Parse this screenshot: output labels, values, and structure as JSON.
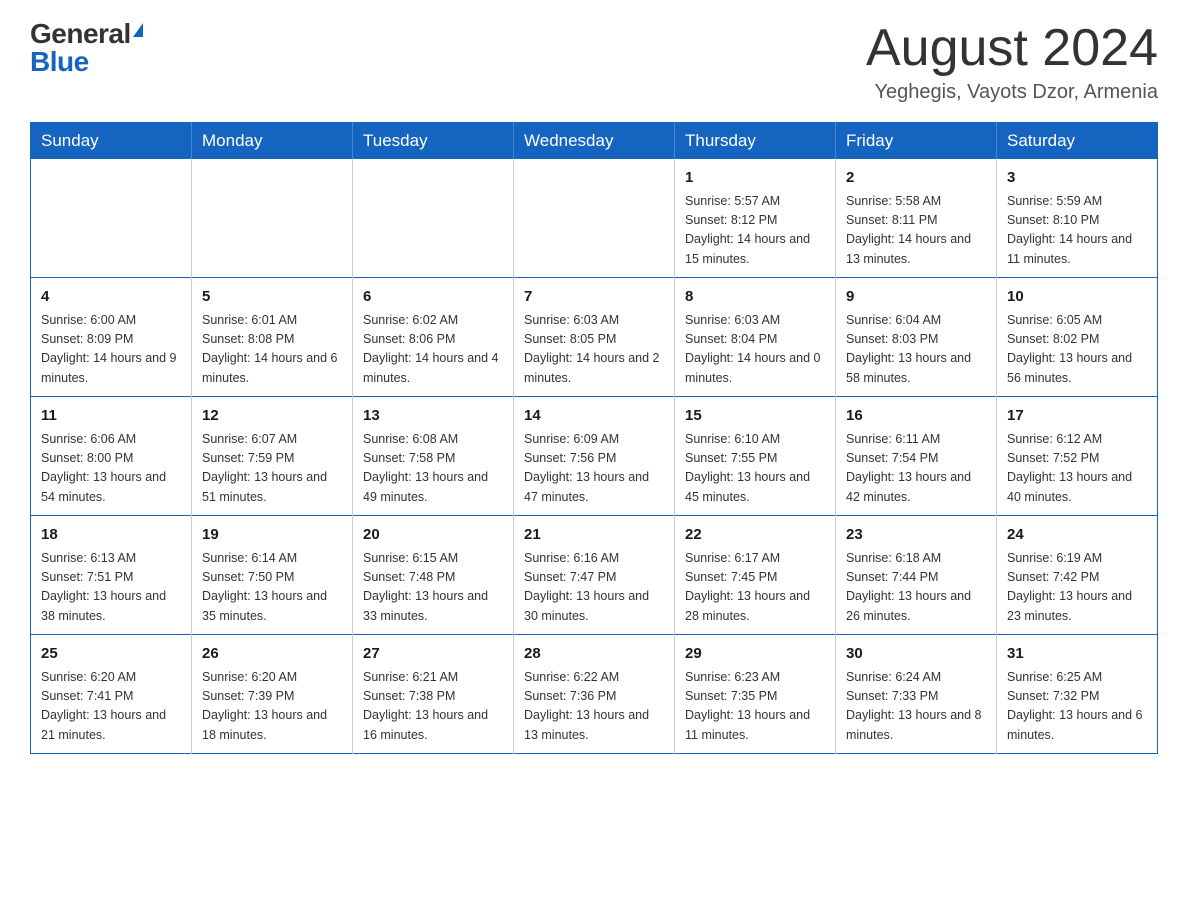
{
  "logo": {
    "general": "General",
    "blue": "Blue"
  },
  "header": {
    "month": "August 2024",
    "location": "Yeghegis, Vayots Dzor, Armenia"
  },
  "weekdays": [
    "Sunday",
    "Monday",
    "Tuesday",
    "Wednesday",
    "Thursday",
    "Friday",
    "Saturday"
  ],
  "weeks": [
    [
      {
        "day": "",
        "info": ""
      },
      {
        "day": "",
        "info": ""
      },
      {
        "day": "",
        "info": ""
      },
      {
        "day": "",
        "info": ""
      },
      {
        "day": "1",
        "info": "Sunrise: 5:57 AM\nSunset: 8:12 PM\nDaylight: 14 hours and 15 minutes."
      },
      {
        "day": "2",
        "info": "Sunrise: 5:58 AM\nSunset: 8:11 PM\nDaylight: 14 hours and 13 minutes."
      },
      {
        "day": "3",
        "info": "Sunrise: 5:59 AM\nSunset: 8:10 PM\nDaylight: 14 hours and 11 minutes."
      }
    ],
    [
      {
        "day": "4",
        "info": "Sunrise: 6:00 AM\nSunset: 8:09 PM\nDaylight: 14 hours and 9 minutes."
      },
      {
        "day": "5",
        "info": "Sunrise: 6:01 AM\nSunset: 8:08 PM\nDaylight: 14 hours and 6 minutes."
      },
      {
        "day": "6",
        "info": "Sunrise: 6:02 AM\nSunset: 8:06 PM\nDaylight: 14 hours and 4 minutes."
      },
      {
        "day": "7",
        "info": "Sunrise: 6:03 AM\nSunset: 8:05 PM\nDaylight: 14 hours and 2 minutes."
      },
      {
        "day": "8",
        "info": "Sunrise: 6:03 AM\nSunset: 8:04 PM\nDaylight: 14 hours and 0 minutes."
      },
      {
        "day": "9",
        "info": "Sunrise: 6:04 AM\nSunset: 8:03 PM\nDaylight: 13 hours and 58 minutes."
      },
      {
        "day": "10",
        "info": "Sunrise: 6:05 AM\nSunset: 8:02 PM\nDaylight: 13 hours and 56 minutes."
      }
    ],
    [
      {
        "day": "11",
        "info": "Sunrise: 6:06 AM\nSunset: 8:00 PM\nDaylight: 13 hours and 54 minutes."
      },
      {
        "day": "12",
        "info": "Sunrise: 6:07 AM\nSunset: 7:59 PM\nDaylight: 13 hours and 51 minutes."
      },
      {
        "day": "13",
        "info": "Sunrise: 6:08 AM\nSunset: 7:58 PM\nDaylight: 13 hours and 49 minutes."
      },
      {
        "day": "14",
        "info": "Sunrise: 6:09 AM\nSunset: 7:56 PM\nDaylight: 13 hours and 47 minutes."
      },
      {
        "day": "15",
        "info": "Sunrise: 6:10 AM\nSunset: 7:55 PM\nDaylight: 13 hours and 45 minutes."
      },
      {
        "day": "16",
        "info": "Sunrise: 6:11 AM\nSunset: 7:54 PM\nDaylight: 13 hours and 42 minutes."
      },
      {
        "day": "17",
        "info": "Sunrise: 6:12 AM\nSunset: 7:52 PM\nDaylight: 13 hours and 40 minutes."
      }
    ],
    [
      {
        "day": "18",
        "info": "Sunrise: 6:13 AM\nSunset: 7:51 PM\nDaylight: 13 hours and 38 minutes."
      },
      {
        "day": "19",
        "info": "Sunrise: 6:14 AM\nSunset: 7:50 PM\nDaylight: 13 hours and 35 minutes."
      },
      {
        "day": "20",
        "info": "Sunrise: 6:15 AM\nSunset: 7:48 PM\nDaylight: 13 hours and 33 minutes."
      },
      {
        "day": "21",
        "info": "Sunrise: 6:16 AM\nSunset: 7:47 PM\nDaylight: 13 hours and 30 minutes."
      },
      {
        "day": "22",
        "info": "Sunrise: 6:17 AM\nSunset: 7:45 PM\nDaylight: 13 hours and 28 minutes."
      },
      {
        "day": "23",
        "info": "Sunrise: 6:18 AM\nSunset: 7:44 PM\nDaylight: 13 hours and 26 minutes."
      },
      {
        "day": "24",
        "info": "Sunrise: 6:19 AM\nSunset: 7:42 PM\nDaylight: 13 hours and 23 minutes."
      }
    ],
    [
      {
        "day": "25",
        "info": "Sunrise: 6:20 AM\nSunset: 7:41 PM\nDaylight: 13 hours and 21 minutes."
      },
      {
        "day": "26",
        "info": "Sunrise: 6:20 AM\nSunset: 7:39 PM\nDaylight: 13 hours and 18 minutes."
      },
      {
        "day": "27",
        "info": "Sunrise: 6:21 AM\nSunset: 7:38 PM\nDaylight: 13 hours and 16 minutes."
      },
      {
        "day": "28",
        "info": "Sunrise: 6:22 AM\nSunset: 7:36 PM\nDaylight: 13 hours and 13 minutes."
      },
      {
        "day": "29",
        "info": "Sunrise: 6:23 AM\nSunset: 7:35 PM\nDaylight: 13 hours and 11 minutes."
      },
      {
        "day": "30",
        "info": "Sunrise: 6:24 AM\nSunset: 7:33 PM\nDaylight: 13 hours and 8 minutes."
      },
      {
        "day": "31",
        "info": "Sunrise: 6:25 AM\nSunset: 7:32 PM\nDaylight: 13 hours and 6 minutes."
      }
    ]
  ]
}
